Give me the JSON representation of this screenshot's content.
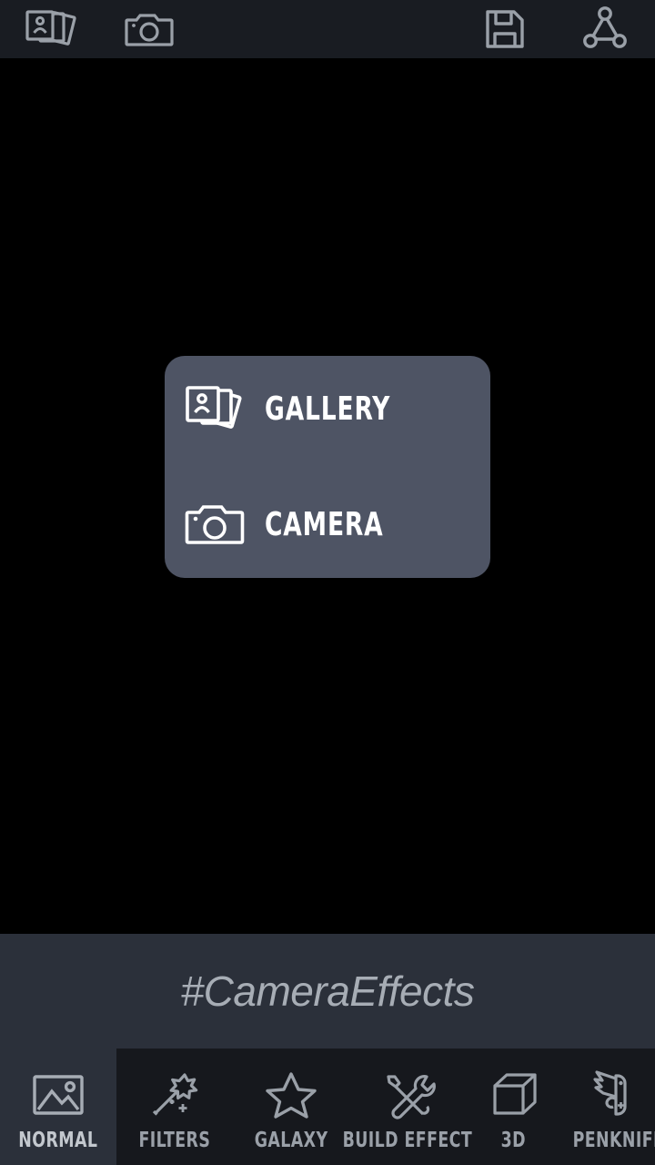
{
  "app": {
    "title": "Camera Effects",
    "colors": {
      "canvas_background": "#000000",
      "topbar_background": "#191c22",
      "dialog_background": "#4e5464",
      "watermark_band_background": "#2b303a",
      "bottomnav_background": "#16181d",
      "bottomnav_selected_background": "#2b303a",
      "icon_stroke": "#9aa0a8",
      "dialog_text": "#ffffff",
      "watermark_text": "#a7adb5",
      "nav_label": "#9aa0a8",
      "nav_label_selected": "#c3c8ce"
    }
  },
  "topbar": {
    "buttons": [
      {
        "name": "gallery",
        "icon": "gallery-stack-icon",
        "label": ""
      },
      {
        "name": "camera",
        "icon": "camera-icon",
        "label": ""
      },
      {
        "name": "save",
        "icon": "floppy-disk-save-icon",
        "label": ""
      },
      {
        "name": "share",
        "icon": "share-nodes-icon",
        "label": ""
      }
    ]
  },
  "dialog": {
    "visible": true,
    "options": [
      {
        "label": "GALLERY",
        "icon": "gallery-stack-icon"
      },
      {
        "label": "CAMERA",
        "icon": "camera-icon"
      }
    ]
  },
  "watermark": {
    "text": "#CameraEffects"
  },
  "bottomnav": {
    "selected_index": 0,
    "items": [
      {
        "label": "NORMAL",
        "icon": "image-picture-icon",
        "selected": true
      },
      {
        "label": "FILTERS",
        "icon": "magic-wand-icon",
        "selected": false
      },
      {
        "label": "GALAXY",
        "icon": "star-outline-icon",
        "selected": false
      },
      {
        "label": "BUILD EFFECT",
        "icon": "tools-cross-icon",
        "selected": false
      },
      {
        "label": "3D",
        "icon": "cube-icon",
        "selected": false
      },
      {
        "label": "PENKNIFE",
        "icon": "penknife-icon",
        "selected": false
      }
    ]
  }
}
